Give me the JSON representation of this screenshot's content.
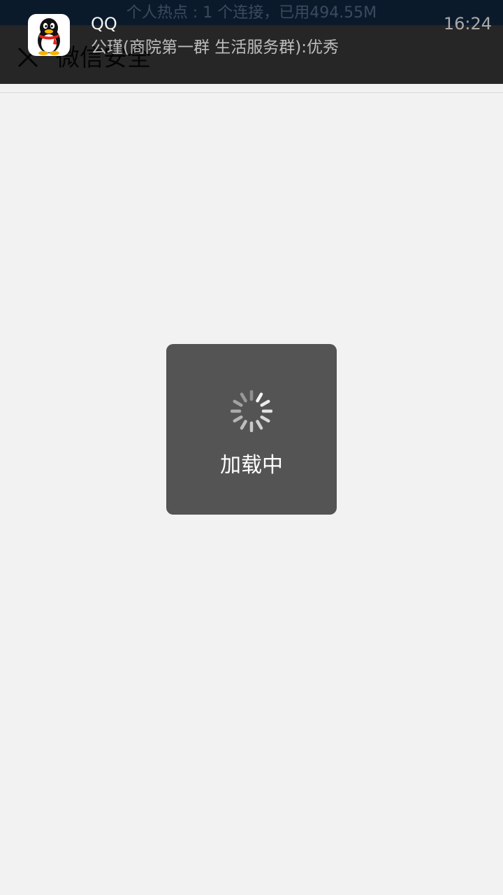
{
  "status_bar": {
    "hotspot_text": "个人热点 : 1 个连接，已用494.55M"
  },
  "title_bar": {
    "close_icon": "close-icon",
    "title": "微信安全"
  },
  "notification": {
    "app_name": "QQ",
    "message": "公瑾(商院第一群  生活服务群):优秀",
    "time": "16:24",
    "icon": "qq-penguin-icon"
  },
  "loading": {
    "text": "加载中",
    "icon": "spinner-icon"
  },
  "colors": {
    "background": "#f2f2f2",
    "title_bar": "#262626",
    "toast": "#545454"
  }
}
